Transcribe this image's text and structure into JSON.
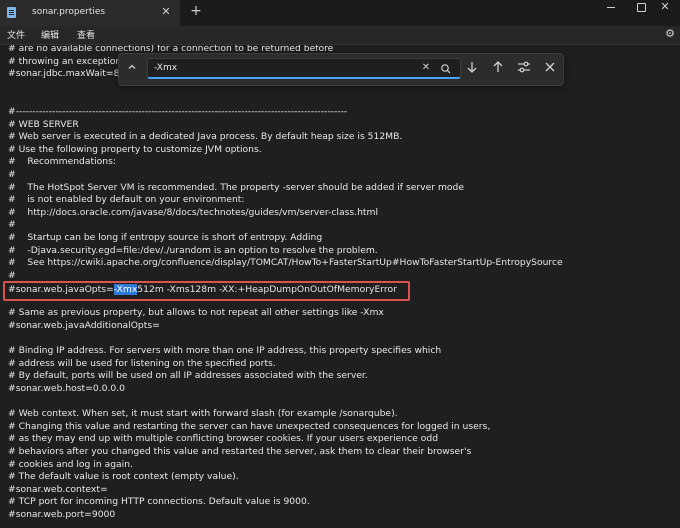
{
  "window": {
    "tab_title": "sonar.properties",
    "tab_close": "✕",
    "new_tab": "+",
    "close": "✕"
  },
  "menu": {
    "file": "文件",
    "edit": "编辑",
    "view": "查看"
  },
  "find": {
    "query": "-Xmx",
    "clear": "✕"
  },
  "editor": {
    "lines": [
      "# are no available connections) for a connection to be returned before",
      "# throwing an exception",
      "#sonar.jdbc.maxWait=8",
      "",
      "",
      "#----------------------------------------------------------------------------------------------------",
      "# WEB SERVER",
      "# Web server is executed in a dedicated Java process. By default heap size is 512MB.",
      "# Use the following property to customize JVM options.",
      "#    Recommendations:",
      "#",
      "#    The HotSpot Server VM is recommended. The property -server should be added if server mode",
      "#    is not enabled by default on your environment:",
      "#    http://docs.oracle.com/javase/8/docs/technotes/guides/vm/server-class.html",
      "#",
      "#    Startup can be long if entropy source is short of entropy. Adding",
      "#    -Djava.security.egd=file:/dev/./urandom is an option to resolve the problem.",
      "#    See https://cwiki.apache.org/confluence/display/TOMCAT/HowTo+FasterStartUp#HowToFasterStartUp-EntropySource",
      "#",
      "",
      "",
      "# Same as previous property, but allows to not repeat all other settings like -Xmx",
      "#sonar.web.javaAdditionalOpts=",
      "",
      "# Binding IP address. For servers with more than one IP address, this property specifies which",
      "# address will be used for listening on the specified ports.",
      "# By default, ports will be used on all IP addresses associated with the server.",
      "#sonar.web.host=0.0.0.0",
      "",
      "# Web context. When set, it must start with forward slash (for example /sonarqube).",
      "# Changing this value and restarting the server can have unexpected consequences for logged in users,",
      "# as they may end up with multiple conflicting browser cookies. If your users experience odd",
      "# behaviors after you changed this value and restarted the server, ask them to clear their browser's",
      "# cookies and log in again.",
      "# The default value is root context (empty value).",
      "#sonar.web.context=",
      "# TCP port for incoming HTTP connections. Default value is 9000.",
      "#sonar.web.port=9000"
    ],
    "highlight_prefix": "#sonar.web.javaOpts=",
    "highlight_match": "-Xmx",
    "highlight_suffix": "512m -Xms128m -XX:+HeapDumpOnOutOfMemoryError",
    "match_color": "#2f7ad6",
    "highlight_border_color": "#d9534f"
  }
}
